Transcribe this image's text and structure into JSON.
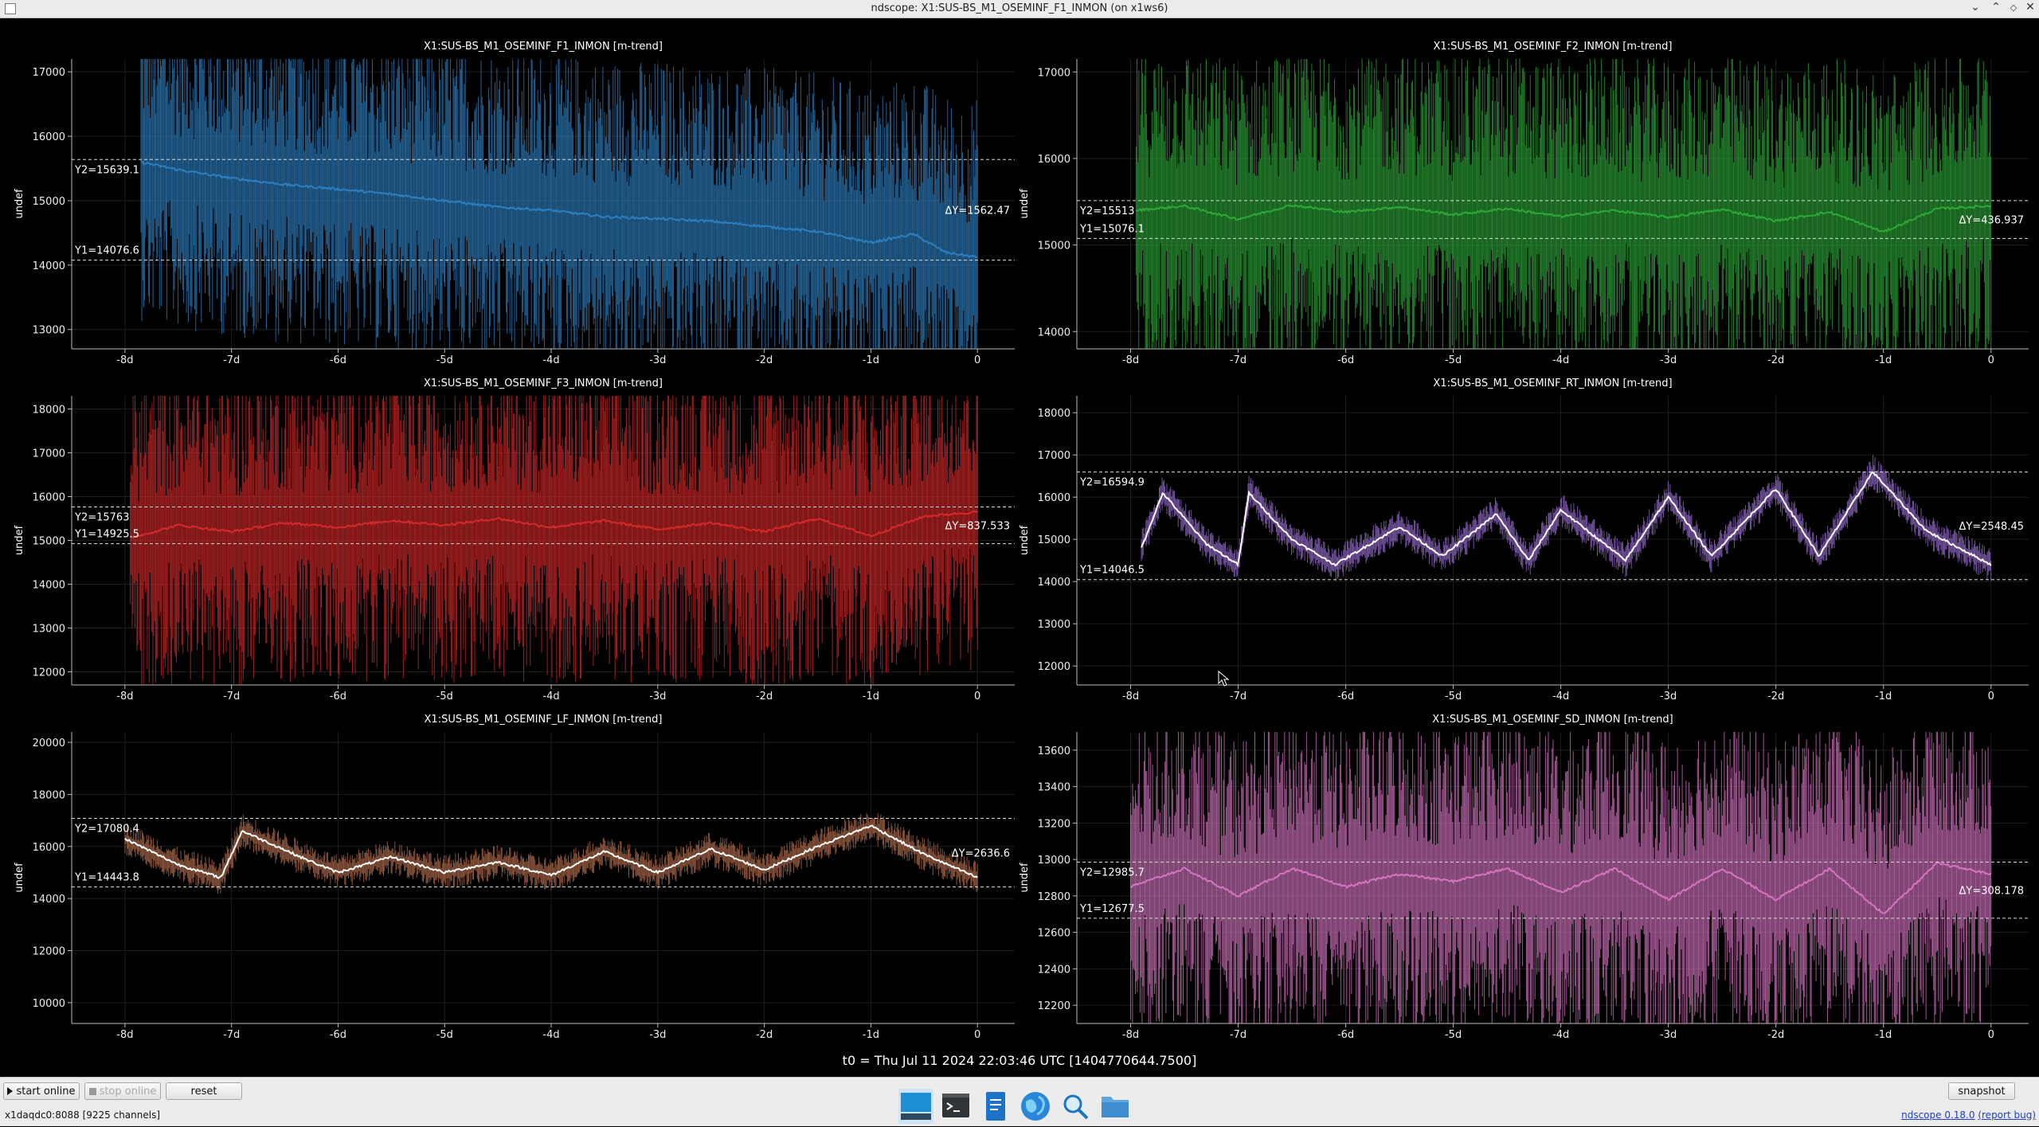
{
  "window": {
    "title": "ndscope: X1:SUS-BS_M1_OSEMINF_F1_INMON (on x1ws6)"
  },
  "t0_label": "t0 = Thu Jul 11 2024 22:03:46 UTC [1404770644.7500]",
  "toolbar": {
    "start_online": "start online",
    "stop_online": "stop online",
    "reset": "reset",
    "snapshot": "snapshot"
  },
  "status": {
    "server": "x1daqdc0:8088  [9225 channels]"
  },
  "version": {
    "text": "ndscope 0.18.0",
    "report": "(report bug)"
  },
  "taskbar": {
    "icons": [
      "desktop-icon",
      "terminal-icon",
      "text-editor-icon",
      "web-browser-icon",
      "search-icon",
      "file-manager-icon"
    ]
  },
  "colors": {
    "blue": "#2e7fc0",
    "green": "#2ea83a",
    "red": "#d42a2a",
    "purple": "#9b6ed3",
    "brown": "#b8704f",
    "pink": "#d575c2"
  },
  "chart_data": [
    {
      "type": "line",
      "title": "X1:SUS-BS_M1_OSEMINF_F1_INMON [m-trend]",
      "ylabel": "undef",
      "color": "#2e7fc0",
      "xticks": [
        "-8d",
        "-7d",
        "-6d",
        "-5d",
        "-4d",
        "-3d",
        "-2d",
        "-1d",
        "0"
      ],
      "xlim": [
        -8.5,
        0.35
      ],
      "ylim": [
        12700,
        17200
      ],
      "yticks": [
        13000,
        14000,
        15000,
        16000,
        17000
      ],
      "y1": "Y1=14076.6",
      "y2": "Y2=15639.1",
      "dy": "ΔY=1562.47",
      "mean_x": [
        -7.85,
        -7.5,
        -7,
        -6.5,
        -6,
        -5.5,
        -5,
        -4.5,
        -4,
        -3.5,
        -3,
        -2.5,
        -2,
        -1.5,
        -1,
        -0.6,
        -0.3,
        0
      ],
      "mean_y": [
        15600,
        15480,
        15350,
        15250,
        15180,
        15100,
        15000,
        14900,
        14850,
        14750,
        14720,
        14680,
        14600,
        14520,
        14350,
        14480,
        14200,
        14120
      ]
    },
    {
      "type": "line",
      "title": "X1:SUS-BS_M1_OSEMINF_F2_INMON [m-trend]",
      "ylabel": "undef",
      "color": "#2ea83a",
      "xticks": [
        "-8d",
        "-7d",
        "-6d",
        "-5d",
        "-4d",
        "-3d",
        "-2d",
        "-1d",
        "0"
      ],
      "xlim": [
        -8.5,
        0.35
      ],
      "ylim": [
        13800,
        17150
      ],
      "yticks": [
        14000,
        15000,
        16000,
        17000
      ],
      "y1": "Y1=15076.1",
      "y2": "Y2=15513",
      "dy": "ΔY=436.937",
      "mean_x": [
        -7.95,
        -7.5,
        -7,
        -6.5,
        -6,
        -5.5,
        -5,
        -4.5,
        -4,
        -3.5,
        -3,
        -2.5,
        -2,
        -1.5,
        -1,
        -0.5,
        0
      ],
      "mean_y": [
        15400,
        15450,
        15300,
        15460,
        15380,
        15440,
        15350,
        15420,
        15330,
        15400,
        15320,
        15410,
        15280,
        15380,
        15150,
        15420,
        15450
      ]
    },
    {
      "type": "line",
      "title": "X1:SUS-BS_M1_OSEMINF_F3_INMON [m-trend]",
      "ylabel": "undef",
      "color": "#d42a2a",
      "xticks": [
        "-8d",
        "-7d",
        "-6d",
        "-5d",
        "-4d",
        "-3d",
        "-2d",
        "-1d",
        "0"
      ],
      "xlim": [
        -8.5,
        0.35
      ],
      "ylim": [
        11700,
        18300
      ],
      "yticks": [
        12000,
        13000,
        14000,
        15000,
        16000,
        17000,
        18000
      ],
      "y1": "Y1=14925.5",
      "y2": "Y2=15763",
      "dy": "ΔY=837.533",
      "mean_x": [
        -7.95,
        -7.5,
        -7,
        -6.5,
        -6,
        -5.5,
        -5,
        -4.5,
        -4,
        -3.5,
        -3,
        -2.5,
        -2,
        -1.5,
        -1,
        -0.5,
        0
      ],
      "mean_y": [
        15050,
        15350,
        15200,
        15400,
        15300,
        15450,
        15350,
        15500,
        15300,
        15450,
        15250,
        15400,
        15200,
        15500,
        15100,
        15550,
        15650
      ]
    },
    {
      "type": "line",
      "title": "X1:SUS-BS_M1_OSEMINF_RT_INMON [m-trend]",
      "ylabel": "undef",
      "color": "#9b6ed3",
      "xticks": [
        "-8d",
        "-7d",
        "-6d",
        "-5d",
        "-4d",
        "-3d",
        "-2d",
        "-1d",
        "0"
      ],
      "xlim": [
        -8.5,
        0.35
      ],
      "ylim": [
        11550,
        18400
      ],
      "yticks": [
        12000,
        13000,
        14000,
        15000,
        16000,
        17000,
        18000
      ],
      "y1": "Y1=14046.5",
      "y2": "Y2=16594.9",
      "dy": "ΔY=2548.45",
      "mean_x": [
        -7.9,
        -7.7,
        -7.3,
        -7,
        -6.9,
        -6.5,
        -6.1,
        -5.5,
        -5.1,
        -4.6,
        -4.3,
        -4,
        -3.4,
        -3,
        -2.6,
        -2,
        -1.6,
        -1.1,
        -0.6,
        0
      ],
      "mean_y": [
        14800,
        16100,
        14900,
        14400,
        16100,
        15000,
        14400,
        15300,
        14600,
        15600,
        14500,
        15700,
        14500,
        16000,
        14600,
        16200,
        14600,
        16600,
        15200,
        14400
      ]
    },
    {
      "type": "line",
      "title": "X1:SUS-BS_M1_OSEMINF_LF_INMON [m-trend]",
      "ylabel": "undef",
      "color": "#b8704f",
      "xticks": [
        "-8d",
        "-7d",
        "-6d",
        "-5d",
        "-4d",
        "-3d",
        "-2d",
        "-1d",
        "0"
      ],
      "xlim": [
        -8.5,
        0.35
      ],
      "ylim": [
        9200,
        20400
      ],
      "yticks": [
        10000,
        12000,
        14000,
        16000,
        18000,
        20000
      ],
      "y1": "Y1=14443.8",
      "y2": "Y2=17080.4",
      "dy": "ΔY=2636.6",
      "mean_x": [
        -8,
        -7.5,
        -7.1,
        -6.9,
        -6.3,
        -6,
        -5.5,
        -5,
        -4.5,
        -4,
        -3.5,
        -3,
        -2.5,
        -2,
        -1.5,
        -1,
        -0.5,
        0
      ],
      "mean_y": [
        16300,
        15300,
        14800,
        16600,
        15500,
        15000,
        15600,
        15000,
        15400,
        14900,
        15800,
        15000,
        15900,
        15100,
        16000,
        16800,
        15700,
        14800
      ]
    },
    {
      "type": "line",
      "title": "X1:SUS-BS_M1_OSEMINF_SD_INMON [m-trend]",
      "ylabel": "undef",
      "color": "#d575c2",
      "xticks": [
        "-8d",
        "-7d",
        "-6d",
        "-5d",
        "-4d",
        "-3d",
        "-2d",
        "-1d",
        "0"
      ],
      "xlim": [
        -8.5,
        0.35
      ],
      "ylim": [
        12100,
        13700
      ],
      "yticks": [
        12200,
        12400,
        12600,
        12800,
        13000,
        13200,
        13400,
        13600
      ],
      "y1": "Y1=12677.5",
      "y2": "Y2=12985.7",
      "dy": "ΔY=308.178",
      "mean_x": [
        -8,
        -7.5,
        -7,
        -6.5,
        -6,
        -5.5,
        -5,
        -4.5,
        -4,
        -3.5,
        -3,
        -2.5,
        -2,
        -1.5,
        -1,
        -0.5,
        0
      ],
      "mean_y": [
        12850,
        12950,
        12800,
        12950,
        12850,
        12920,
        12880,
        12950,
        12820,
        12950,
        12780,
        12950,
        12780,
        12950,
        12700,
        12980,
        12920
      ]
    }
  ]
}
